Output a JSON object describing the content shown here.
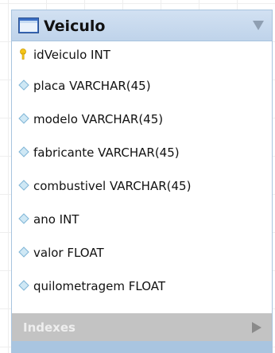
{
  "table": {
    "title": "Veiculo",
    "icon": "table-icon",
    "columns": [
      {
        "label": "idVeiculo INT",
        "icon": "primary-key-icon",
        "icon_color": "#f5c518"
      },
      {
        "label": "placa VARCHAR(45)",
        "icon": "column-diamond-icon",
        "icon_color": "#9ecfe8"
      },
      {
        "label": "modelo VARCHAR(45)",
        "icon": "column-diamond-icon",
        "icon_color": "#9ecfe8"
      },
      {
        "label": "fabricante VARCHAR(45)",
        "icon": "column-diamond-icon",
        "icon_color": "#9ecfe8"
      },
      {
        "label": "combustivel VARCHAR(45)",
        "icon": "column-diamond-icon",
        "icon_color": "#9ecfe8"
      },
      {
        "label": "ano INT",
        "icon": "column-diamond-icon",
        "icon_color": "#9ecfe8"
      },
      {
        "label": "valor FLOAT",
        "icon": "column-diamond-icon",
        "icon_color": "#9ecfe8"
      },
      {
        "label": "quilometragem FLOAT",
        "icon": "column-diamond-icon",
        "icon_color": "#9ecfe8"
      }
    ],
    "indexes_label": "Indexes",
    "colors": {
      "header_bg": "#c8daee",
      "border": "#a8c4df",
      "indexes_bg": "#c3c3c3",
      "footer_bg": "#a9c5e0"
    }
  }
}
